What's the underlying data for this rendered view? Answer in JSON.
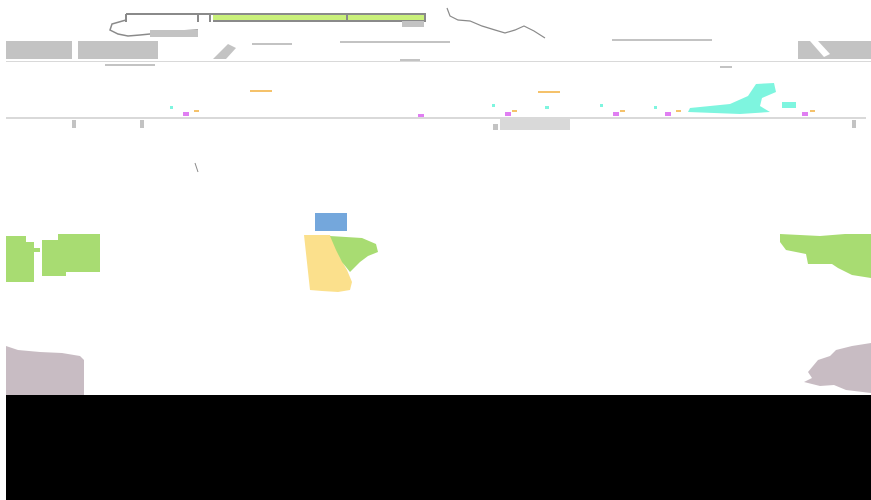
{
  "map": {
    "colors": {
      "background": "#ffffff",
      "lime": "#c9f07a",
      "border_gray": "#8a8a8a",
      "gray_block": "#c3c3c3",
      "light_gray": "#d9d9d9",
      "aqua": "#7ef5df",
      "magenta": "#e07ef2",
      "orange": "#f5c26b",
      "green": "#a8dc72",
      "yellow": "#fbe08c",
      "blue": "#74a7dc",
      "mauve": "#c8bcc3",
      "black": "#000000"
    },
    "labels": []
  }
}
